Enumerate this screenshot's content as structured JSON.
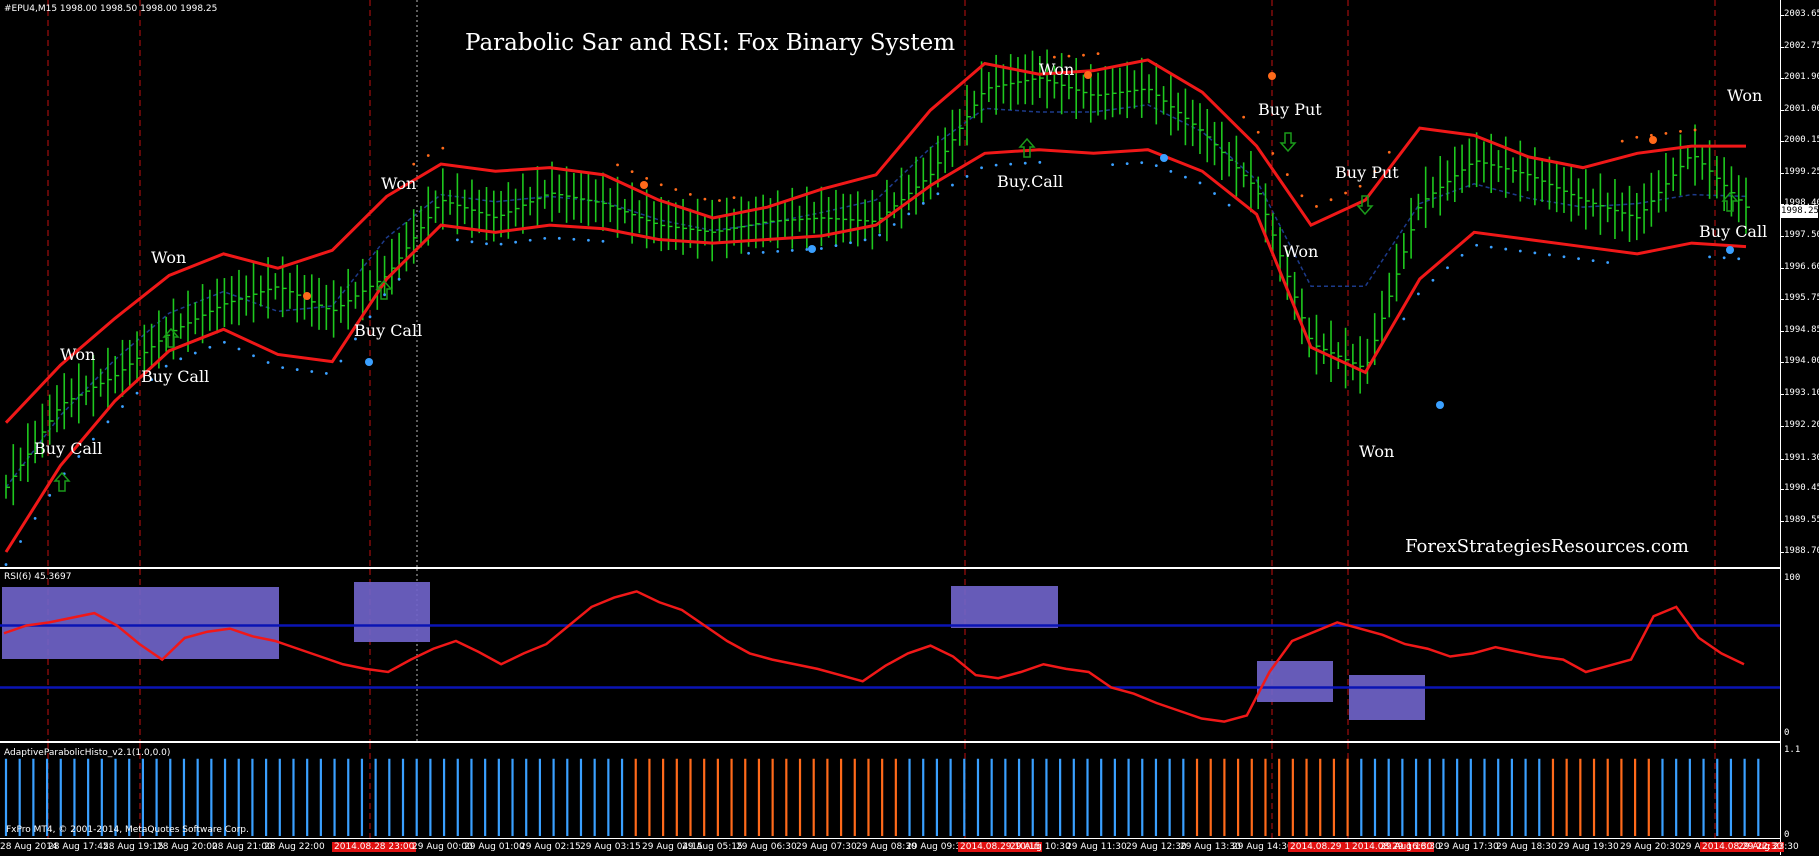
{
  "window": {
    "symbol_header": "#EPU4,M15  1998.00 1998.50 1998.00 1998.25",
    "title": "Parabolic Sar and RSI: Fox Binary System",
    "watermark": "ForexStrategiesResources.com",
    "current_price": "1998.25",
    "copyright": "FxPro MT4, © 2001-2014, MetaQuotes Software Corp."
  },
  "colors": {
    "bull_bar": "#1ec81e",
    "envelope": "#f01818",
    "sar_up": "#3aa0ff",
    "sar_down": "#ff6a1a",
    "midline": "#1c3a8a",
    "rsi_box": "#6f63c8",
    "rsi_level": "#0a14b4",
    "histo_blue": "#3aa0ff",
    "histo_orange": "#ff6a1a",
    "arrow": "#0b6e0b"
  },
  "chart_data": [
    {
      "type": "line",
      "name": "price",
      "y_axis": {
        "min": 1988.7,
        "max": 2003.65
      },
      "y_ticks": [
        "2003.65",
        "2002.75",
        "2001.90",
        "2001.00",
        "2000.15",
        "1999.25",
        "1998.40",
        "1997.50",
        "1996.60",
        "1995.75",
        "1994.85",
        "1994.00",
        "1993.10",
        "1992.20",
        "1991.30",
        "1990.45",
        "1989.55",
        "1988.70"
      ],
      "x": [
        "28 Aug 2014",
        "28 Aug 17:45",
        "28 Aug 19:15",
        "28 Aug 20:00",
        "28 Aug 21:00",
        "28 Aug 22:00",
        "2014.08.28 23:00",
        "29 Aug 00:00",
        "29 Aug 01:00",
        "29 Aug 02:15",
        "29 Aug 03:15",
        "29 Aug 04:15",
        "29 Aug 05:15",
        "29 Aug 06:30",
        "29 Aug 07:30",
        "29 Aug 08:30",
        "29 Aug 09:30",
        "2014.08.29 10:15",
        "29 Aug 10:30",
        "29 Aug 11:30",
        "29 Aug 12:30",
        "29 Aug 13:30",
        "29 Aug 14:30",
        "2014.08.29 15:15",
        "2014.08.29 16:30",
        "29 Aug 16:30",
        "29 Aug 17:30",
        "29 Aug 18:30",
        "29 Aug 19:30",
        "29 Aug 20:30",
        "29 Aug 21:30",
        "2014.08.29 22:30",
        "29 Aug 23:30"
      ],
      "series": [
        {
          "name": "close",
          "values": [
            1990.5,
            1992.8,
            1993.6,
            1994.8,
            1995.6,
            1996.1,
            1995.4,
            1996.4,
            1998.5,
            1998.0,
            1998.7,
            1998.4,
            1997.8,
            1997.6,
            1997.9,
            1998.0,
            1997.9,
            1999.2,
            2001.6,
            2001.9,
            2001.4,
            2001.6,
            2000.4,
            1998.8,
            1994.5,
            1993.8,
            1998.4,
            1999.6,
            1999.2,
            1998.5,
            1998.0,
            1999.8,
            1998.3
          ]
        },
        {
          "name": "upper_band",
          "values": [
            1992.3,
            1993.9,
            1995.2,
            1996.4,
            1997.0,
            1996.6,
            1997.1,
            1998.6,
            1999.5,
            1999.3,
            1999.4,
            1999.2,
            1998.5,
            1998.0,
            1998.3,
            1998.8,
            1999.2,
            2001.0,
            2002.3,
            2002.0,
            2002.1,
            2002.4,
            2001.5,
            2000.0,
            1997.8,
            1998.5,
            2000.5,
            2000.3,
            1999.7,
            1999.4,
            1999.8,
            2000.0,
            2000.0
          ]
        },
        {
          "name": "lower_band",
          "values": [
            1988.7,
            1991.1,
            1992.9,
            1994.3,
            1994.9,
            1994.2,
            1994.0,
            1996.3,
            1997.8,
            1997.6,
            1997.8,
            1997.7,
            1997.4,
            1997.3,
            1997.4,
            1997.5,
            1997.8,
            1998.9,
            1999.8,
            1999.9,
            1999.8,
            1999.9,
            1999.3,
            1998.1,
            1994.4,
            1993.7,
            1996.3,
            1997.6,
            1997.4,
            1997.2,
            1997.0,
            1997.3,
            1997.2
          ]
        }
      ]
    },
    {
      "type": "line",
      "name": "RSI(6) 45.3697",
      "y_axis": {
        "min": 0,
        "max": 100
      },
      "y_ticks": [
        "100",
        "0"
      ],
      "levels": [
        70,
        30
      ],
      "series": [
        {
          "name": "RSI(6)",
          "values": [
            65,
            70,
            72,
            75,
            78,
            70,
            58,
            48,
            62,
            66,
            68,
            63,
            60,
            55,
            50,
            45,
            42,
            40,
            48,
            55,
            60,
            53,
            45,
            52,
            58,
            70,
            82,
            88,
            92,
            85,
            80,
            70,
            60,
            52,
            48,
            45,
            42,
            38,
            34,
            44,
            52,
            57,
            50,
            38,
            36,
            40,
            45,
            42,
            40,
            30,
            26,
            20,
            15,
            10,
            8,
            12,
            40,
            60,
            66,
            72,
            68,
            64,
            58,
            55,
            50,
            52,
            56,
            53,
            50,
            48,
            40,
            44,
            48,
            76,
            82,
            62,
            52,
            45
          ]
        }
      ]
    },
    {
      "type": "bar",
      "name": "AdaptiveParabolicHisto_v2.1(1.0,0.0)",
      "y_axis": {
        "min": 0,
        "max": 1.1
      },
      "y_ticks": [
        "1.1",
        "0"
      ],
      "series": [
        {
          "name": "state",
          "values": [
            1,
            1,
            1,
            1,
            1,
            1,
            1,
            1,
            1,
            1,
            1,
            1,
            1,
            1,
            1,
            1,
            1,
            1,
            1,
            1,
            1,
            1,
            1,
            1,
            1,
            1,
            1,
            1,
            1,
            1,
            1,
            1,
            1,
            1,
            1,
            1,
            1,
            1,
            1,
            1,
            1,
            1,
            1,
            1,
            1,
            1,
            -1,
            -1,
            -1,
            -1,
            -1,
            -1,
            -1,
            -1,
            -1,
            -1,
            -1,
            -1,
            -1,
            -1,
            -1,
            -1,
            -1,
            -1,
            -1,
            -1,
            1,
            1,
            1,
            1,
            1,
            1,
            1,
            1,
            1,
            1,
            1,
            1,
            1,
            1,
            1,
            1,
            1,
            1,
            1,
            1,
            1,
            -1,
            -1,
            -1,
            -1,
            -1,
            -1,
            -1,
            -1,
            -1,
            -1,
            -1,
            -1,
            1,
            1,
            1,
            1,
            1,
            1,
            1,
            1,
            1,
            1,
            1,
            1,
            1,
            1,
            -1,
            -1,
            -1,
            -1,
            -1,
            -1,
            -1,
            -1,
            1,
            1,
            1,
            1,
            1,
            1,
            1,
            1
          ]
        }
      ]
    }
  ],
  "annotations": [
    {
      "text": "Buy Call"
    },
    {
      "text": "Won"
    },
    {
      "text": "Buy Call"
    },
    {
      "text": "Won"
    },
    {
      "text": "Buy Call"
    },
    {
      "text": "Won"
    },
    {
      "text": "Buy.Call"
    },
    {
      "text": "Won"
    },
    {
      "text": "Buy Put"
    },
    {
      "text": "Won"
    },
    {
      "text": "Buy Put"
    },
    {
      "text": "Won"
    },
    {
      "text": "Buy Call"
    },
    {
      "text": "Won"
    }
  ]
}
